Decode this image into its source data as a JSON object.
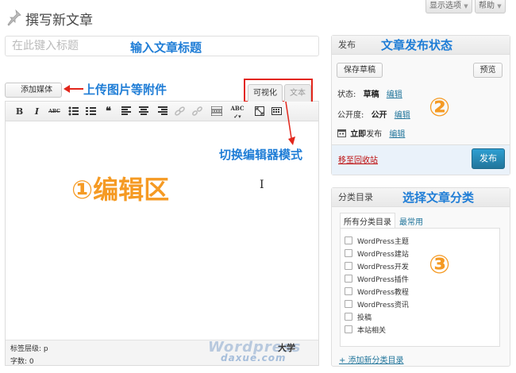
{
  "header": {
    "title": "撰写新文章",
    "screen_options_label": "显示选项",
    "help_label": "帮助"
  },
  "title_field": {
    "placeholder": "在此键入标题"
  },
  "media": {
    "add_media_label": "添加媒体"
  },
  "editor": {
    "tab_visual": "可视化",
    "tab_text": "文本",
    "toolbar": [
      "B",
      "I",
      "ABC",
      "bullet-list",
      "numbered-list",
      "blockquote",
      "align-left",
      "align-center",
      "align-right",
      "link",
      "unlink",
      "more",
      "spellcheck",
      "fullscreen",
      "kitchen-sink"
    ],
    "tag_path": "标签层级: p",
    "word_count": "字数: 0"
  },
  "publish": {
    "heading": "发布",
    "save_draft": "保存草稿",
    "preview": "预览",
    "status_label": "状态:",
    "status_value": "草稿",
    "visibility_label": "公开度:",
    "visibility_value": "公开",
    "schedule_prefix": "立即",
    "schedule_suffix": "发布",
    "edit_link": "编辑",
    "trash": "移至回收站",
    "publish_button": "发布"
  },
  "categories": {
    "heading": "分类目录",
    "tab_all": "所有分类目录",
    "tab_popular": "最常用",
    "items": [
      "WordPress主题",
      "WordPress建站",
      "WordPress开发",
      "WordPress插件",
      "WordPress教程",
      "WordPress资讯",
      "投稿",
      "本站相关"
    ],
    "add_new": "+ 添加新分类目录"
  },
  "annotations": {
    "title_hint": "输入文章标题",
    "publish_hint": "文章发布状态",
    "upload_hint": "上传图片等附件",
    "mode_hint": "切换编辑器模式",
    "editor_area": "①编辑区",
    "circle_2": "②",
    "category_hint": "选择文章分类",
    "circle_3": "③"
  },
  "watermark": {
    "brand": "Wordpress",
    "cn": "大学",
    "domain": "daxue.com"
  },
  "colors": {
    "annotation_blue": "#1f7dd6",
    "annotation_orange": "#f59a23",
    "annotation_red": "#e2261b",
    "link": "#21759b",
    "publish_button": "#21759b"
  }
}
